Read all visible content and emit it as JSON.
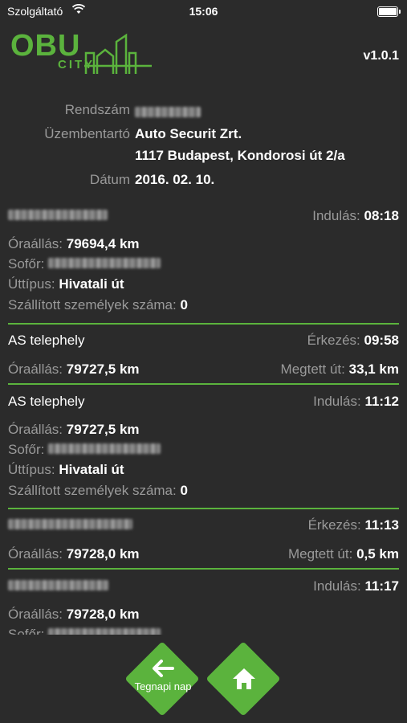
{
  "status_bar": {
    "carrier": "Szolgáltató",
    "time": "15:06"
  },
  "header": {
    "logo_obu": "OBU",
    "logo_city": "CITY",
    "version": "v1.0.1"
  },
  "info": {
    "plate_label": "Rendszám",
    "operator_label": "Üzembentartó",
    "operator_name": "Auto Securit Zrt.",
    "operator_address": "1117 Budapest, Kondorosi út 2/a",
    "date_label": "Dátum",
    "date": "2016. 02. 10."
  },
  "labels": {
    "departure": "Indulás:",
    "arrival": "Érkezés:",
    "odometer": "Óraállás:",
    "driver": "Sofőr:",
    "trip_type": "Úttípus:",
    "passengers": "Szállított személyek száma:",
    "distance": "Megtett út:"
  },
  "entries": [
    {
      "location": "",
      "departure": "08:18",
      "odometer": "79694,4 km",
      "trip_type": "Hivatali út",
      "passengers": "0"
    },
    {
      "location": "AS telephely",
      "arrival": "09:58",
      "odometer": "79727,5 km",
      "distance": "33,1 km"
    },
    {
      "location": "AS telephely",
      "departure": "11:12",
      "odometer": "79727,5 km",
      "trip_type": "Hivatali út",
      "passengers": "0"
    },
    {
      "location": "",
      "arrival": "11:13",
      "odometer": "79728,0 km",
      "distance": "0,5 km"
    },
    {
      "location": "",
      "departure": "11:17",
      "odometer": "79728,0 km"
    }
  ],
  "footer": {
    "back_label": "Tegnapi nap"
  },
  "colors": {
    "accent": "#5bb33d",
    "background": "#2b2b2b",
    "muted_text": "#9a9a9a"
  },
  "icons": {
    "back": "arrow-left-icon",
    "home": "home-icon",
    "wifi": "wifi-icon",
    "battery": "battery-icon"
  }
}
